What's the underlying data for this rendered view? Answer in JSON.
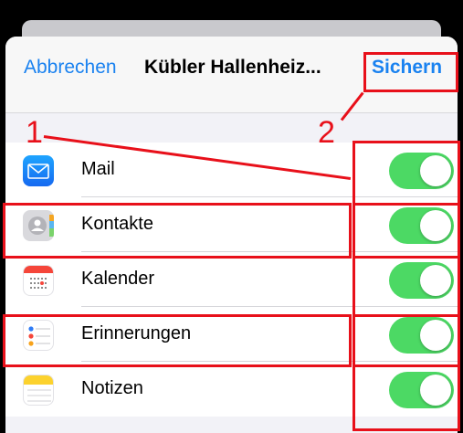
{
  "nav": {
    "cancel": "Abbrechen",
    "title": "Kübler Hallenheiz...",
    "save": "Sichern"
  },
  "rows": [
    {
      "label": "Mail",
      "icon": "mail-icon",
      "enabled": true
    },
    {
      "label": "Kontakte",
      "icon": "contacts-icon",
      "enabled": true
    },
    {
      "label": "Kalender",
      "icon": "calendar-icon",
      "enabled": true
    },
    {
      "label": "Erinnerungen",
      "icon": "reminders-icon",
      "enabled": true
    },
    {
      "label": "Notizen",
      "icon": "notes-icon",
      "enabled": true
    }
  ],
  "annotations": {
    "one": "1",
    "two": "2"
  },
  "colors": {
    "accent": "#1a82f0",
    "toggle_on": "#4cd964",
    "annotation": "#e8101a"
  }
}
